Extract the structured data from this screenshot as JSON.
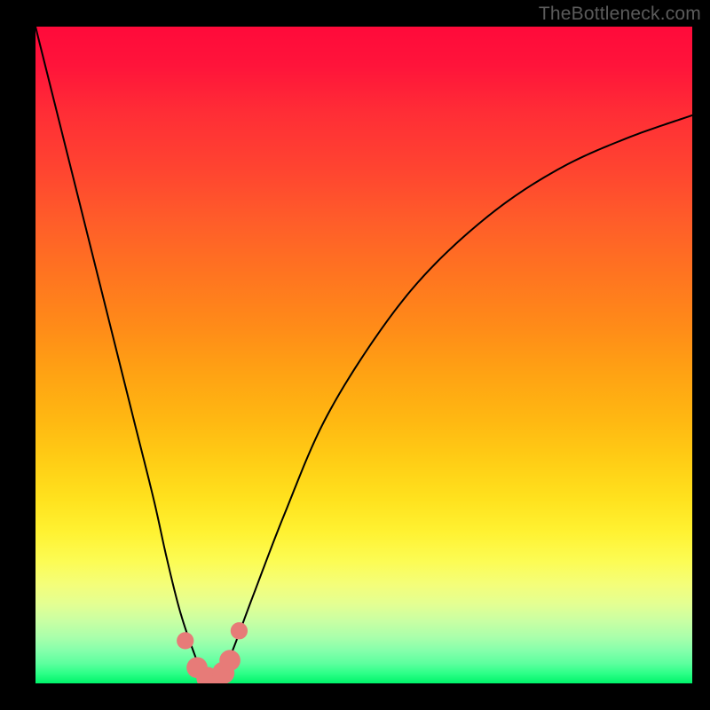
{
  "watermark": "TheBottleneck.com",
  "chart_data": {
    "type": "line",
    "title": "",
    "xlabel": "",
    "ylabel": "",
    "xlim": [
      0,
      100
    ],
    "ylim": [
      0,
      100
    ],
    "background_gradient": {
      "orientation": "vertical",
      "stops": [
        {
          "pct": 0,
          "color": "#ff0a3a"
        },
        {
          "pct": 50,
          "color": "#ff9a14"
        },
        {
          "pct": 80,
          "color": "#fcfc55"
        },
        {
          "pct": 100,
          "color": "#00f36a"
        }
      ]
    },
    "series": [
      {
        "name": "bottleneck-curve",
        "color": "#000000",
        "x": [
          0,
          3,
          6,
          9,
          12,
          15,
          18,
          20,
          22,
          24,
          25.5,
          27,
          28.3,
          30,
          33,
          38,
          44,
          52,
          60,
          70,
          80,
          90,
          100
        ],
        "y": [
          100,
          88,
          76,
          64,
          52,
          40,
          28,
          19,
          11,
          5,
          1.5,
          0.5,
          1.5,
          5,
          13,
          26,
          40,
          53,
          63,
          72,
          78.5,
          83,
          86.5
        ]
      }
    ],
    "markers": {
      "color": "#e77b78",
      "points": [
        {
          "x": 22.8,
          "y": 6.5,
          "r": 1.3
        },
        {
          "x": 24.6,
          "y": 2.4,
          "r": 1.6
        },
        {
          "x": 26.2,
          "y": 0.8,
          "r": 1.7
        },
        {
          "x": 27.3,
          "y": 0.6,
          "r": 1.7
        },
        {
          "x": 28.6,
          "y": 1.6,
          "r": 1.7
        },
        {
          "x": 29.6,
          "y": 3.5,
          "r": 1.6
        },
        {
          "x": 31.0,
          "y": 8.0,
          "r": 1.3
        }
      ]
    }
  }
}
